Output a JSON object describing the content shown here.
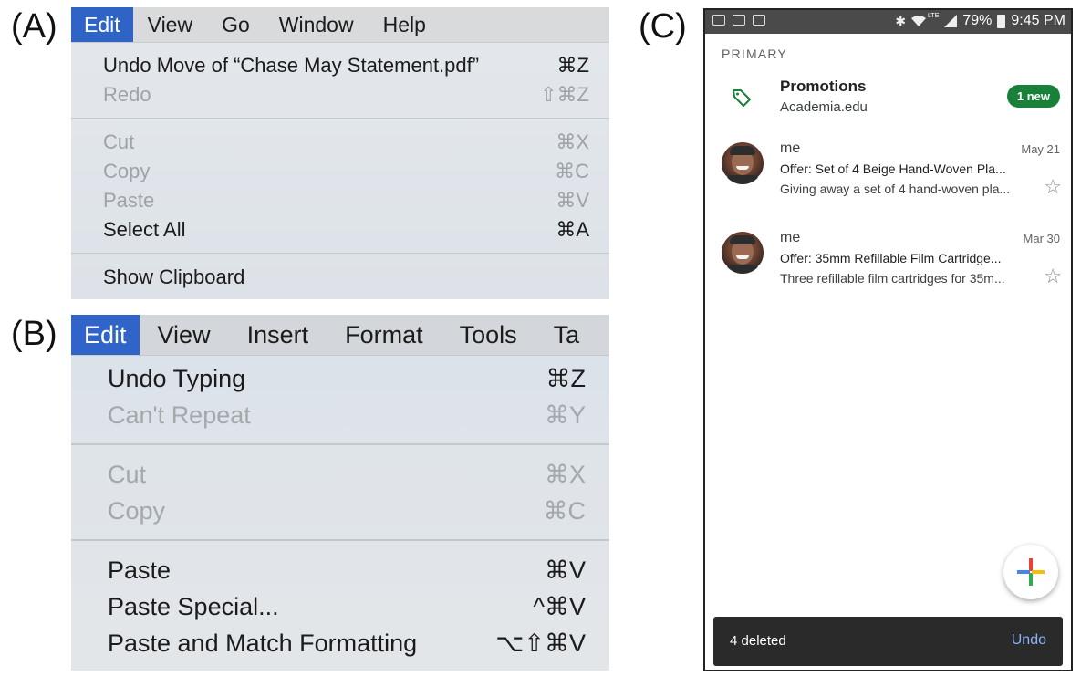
{
  "labels": {
    "a": "(A)",
    "b": "(B)",
    "c": "(C)"
  },
  "panel_a": {
    "menubar": [
      "Edit",
      "View",
      "Go",
      "Window",
      "Help"
    ],
    "groups": [
      [
        {
          "label": "Undo Move of “Chase May Statement.pdf”",
          "shortcut": "⌘Z",
          "enabled": true
        },
        {
          "label": "Redo",
          "shortcut": "⇧⌘Z",
          "enabled": false
        }
      ],
      [
        {
          "label": "Cut",
          "shortcut": "⌘X",
          "enabled": false
        },
        {
          "label": "Copy",
          "shortcut": "⌘C",
          "enabled": false
        },
        {
          "label": "Paste",
          "shortcut": "⌘V",
          "enabled": false
        },
        {
          "label": "Select All",
          "shortcut": "⌘A",
          "enabled": true
        }
      ],
      [
        {
          "label": "Show Clipboard",
          "shortcut": "",
          "enabled": true
        }
      ]
    ]
  },
  "panel_b": {
    "menubar": [
      "Edit",
      "View",
      "Insert",
      "Format",
      "Tools",
      "Ta"
    ],
    "groups": [
      [
        {
          "label": "Undo Typing",
          "shortcut": "⌘Z",
          "enabled": true
        },
        {
          "label": "Can't Repeat",
          "shortcut": "⌘Y",
          "enabled": false
        }
      ],
      [
        {
          "label": "Cut",
          "shortcut": "⌘X",
          "enabled": false
        },
        {
          "label": "Copy",
          "shortcut": "⌘C",
          "enabled": false
        }
      ],
      [
        {
          "label": "Paste",
          "shortcut": "⌘V",
          "enabled": true
        },
        {
          "label": "Paste Special...",
          "shortcut": "^⌘V",
          "enabled": true
        },
        {
          "label": "Paste and Match Formatting",
          "shortcut": "⌥⇧⌘V",
          "enabled": true
        }
      ]
    ]
  },
  "panel_c": {
    "status": {
      "battery": "79%",
      "time": "9:45 PM",
      "network": "LTE"
    },
    "section": "PRIMARY",
    "promotions": {
      "title": "Promotions",
      "subtitle": "Academia.edu",
      "badge": "1 new"
    },
    "emails": [
      {
        "sender": "me",
        "date": "May 21",
        "subject": "Offer: Set of 4 Beige Hand-Woven Pla...",
        "snippet": "Giving away a set of 4 hand-woven pla..."
      },
      {
        "sender": "me",
        "date": "Mar 30",
        "subject": "Offer: 35mm Refillable Film Cartridge...",
        "snippet": "Three refillable film cartridges for 35m..."
      }
    ],
    "snackbar": {
      "text": "4 deleted",
      "action": "Undo"
    },
    "colors": {
      "badge": "#188038",
      "accent_tag": "#188038",
      "snack_action": "#8ab4f8"
    },
    "icons": {
      "tag": "tag-icon",
      "star": "star-outline-icon",
      "compose": "compose-plus-icon"
    }
  }
}
